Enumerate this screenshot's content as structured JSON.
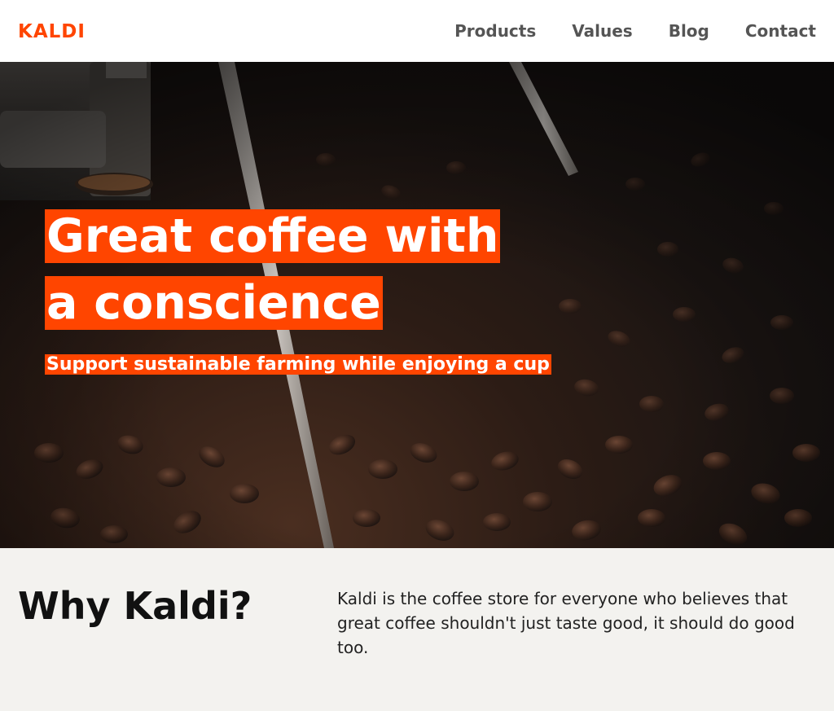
{
  "header": {
    "logo": "KALDI",
    "nav": [
      "Products",
      "Values",
      "Blog",
      "Contact"
    ]
  },
  "hero": {
    "headline": "Great coffee with a conscience",
    "subhead": "Support sustainable farming while enjoying a cup",
    "image": "coffee-roaster-beans"
  },
  "why": {
    "title": "Why Kaldi?",
    "body": "Kaldi is the coffee store for everyone who believes that great coffee shouldn't just taste good, it should do good too."
  },
  "colors": {
    "accent": "#ff4500",
    "nav_text": "#555555",
    "section_bg": "#f3f2ef"
  }
}
